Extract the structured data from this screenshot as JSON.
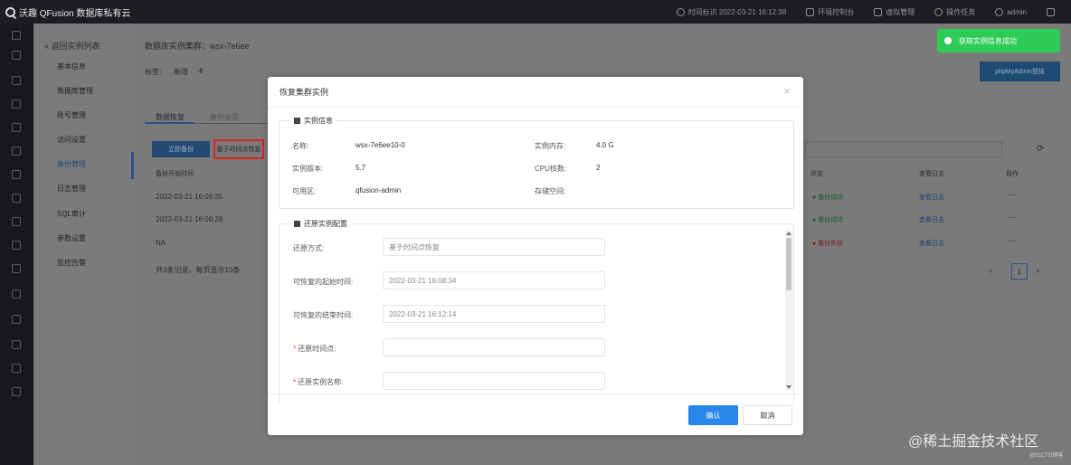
{
  "app": {
    "title": "沃趣 QFusion 数据库私有云"
  },
  "topbar": {
    "time": "时间标识 2022-03-21 16:12:38",
    "items": [
      "环境控制台",
      "虚拟管理",
      "操作任务",
      "admin"
    ]
  },
  "sidebar": {
    "back": "« 返回实例列表",
    "items": [
      "基本信息",
      "数据库管理",
      "账号管理",
      "访问设置",
      "备份管理",
      "日志管理",
      "SQL审计",
      "参数设置",
      "监控告警"
    ]
  },
  "main": {
    "cluster": "数据库实例集群：wsx-7e6ee",
    "tag_label": "标签：",
    "tag_value": "新增",
    "tabs": [
      "数据恢复",
      "备份设置"
    ],
    "btn_backup": "立即备份",
    "btn_time_restore": "基于时间点恢复",
    "col_time": "备份开始时间",
    "rows": [
      "2022-03-21 16:06:35",
      "2022-03-21 16:08:28",
      "NA"
    ],
    "footer": "共3条记录，每页显示10条",
    "status_header": "状态",
    "log_header": "查看日志",
    "op_header": "操作",
    "statuses": [
      "备份成功",
      "备份成功",
      "备份失败"
    ],
    "log_links": [
      "查看日志",
      "查看日志",
      "查看日志"
    ],
    "page": "1",
    "pma_button": "phpMyAdmin登陆"
  },
  "toast": {
    "text": "获取实例信息成功",
    "color": "#2ecc57"
  },
  "modal": {
    "title": "恢复集群实例",
    "section1": "实例信息",
    "info": {
      "name_label": "名称:",
      "name_value": "wsx-7e6ee10-0",
      "memory_label": "实例内存:",
      "memory_value": "4.0 G",
      "version_label": "实例版本:",
      "version_value": "5.7",
      "cpu_label": "CPU核数:",
      "cpu_value": "2",
      "zone_label": "可用区:",
      "zone_value": "qfusion-admin",
      "storage_label": "存储空间:",
      "storage_value": ""
    },
    "section2": "还原实例配置",
    "form": {
      "method_label": "还原方式:",
      "method_value": "基于时间点恢复",
      "start_label": "可恢复的起始时间:",
      "start_value": "2022-03-21 16:08:34",
      "end_label": "可恢复的结束时间:",
      "end_value": "2022-03-21 16:12:14",
      "point_label": "还原时间点:",
      "point_value": "",
      "name_label": "还原实例名称:",
      "name_value": ""
    },
    "ok": "确认",
    "cancel": "取消"
  },
  "watermark": {
    "text": "@稀土掘金技术社区",
    "sub": "@51CTO博客"
  },
  "colors": {
    "primary": "#2b86ea",
    "success": "#2ecc57",
    "danger": "#e33"
  }
}
